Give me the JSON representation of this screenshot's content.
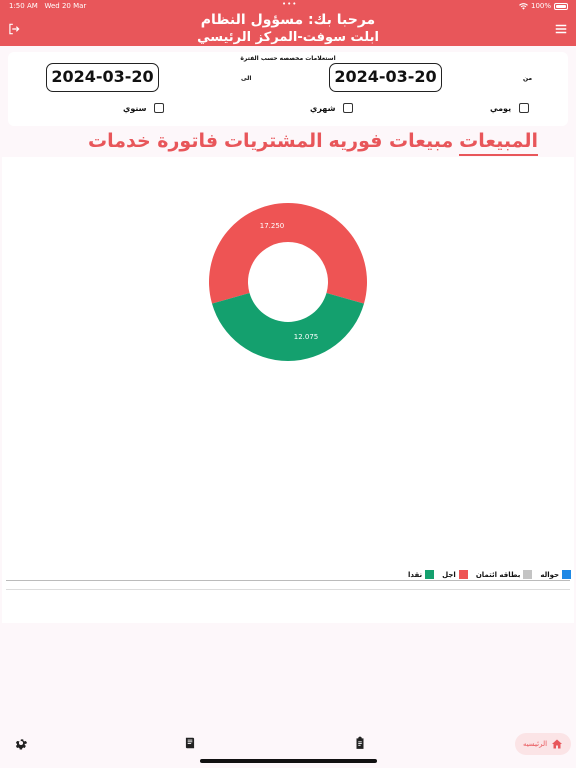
{
  "status_bar": {
    "time": "1:50 AM",
    "date": "Wed 20 Mar",
    "battery": "100%"
  },
  "header": {
    "greeting": "مرحبا بك: مسؤول النظام",
    "company": "ابلت سوفت-المركز الرئيسي",
    "background": "#e8565a"
  },
  "filters": {
    "caption": "استعلامات مخصصه حسب الفترة",
    "from_label": "من",
    "to_label": "الى",
    "from_date": "2024-03-20",
    "to_date": "2024-03-20",
    "periods": [
      {
        "label": "يومي",
        "checked": false
      },
      {
        "label": "شهري",
        "checked": false
      },
      {
        "label": "سنوي",
        "checked": false
      }
    ]
  },
  "tabs": [
    {
      "label": "المبيعات",
      "active": true
    },
    {
      "label": "مبيعات فوريه",
      "active": false
    },
    {
      "label": "المشتريات",
      "active": false
    },
    {
      "label": "فاتورة خدمات",
      "active": false
    }
  ],
  "chart_data": {
    "type": "pie",
    "categories": [
      "اجل",
      "نقدا"
    ],
    "values": [
      17250,
      12075
    ],
    "labels": [
      "17.250",
      "12.075"
    ],
    "colors": [
      "#ee5454",
      "#14a06e"
    ]
  },
  "legend": [
    {
      "label": "نقدا",
      "color": "#14a06e"
    },
    {
      "label": "اجل",
      "color": "#ee5454"
    },
    {
      "label": "بطاقه ائتمان",
      "color": "#c4c4c4"
    },
    {
      "label": "حواله",
      "color": "#1e88e5"
    }
  ],
  "bottom_nav": {
    "home_label": "الرئيسيه",
    "accent": "#e8565a"
  },
  "icons": {
    "logout": "logout-icon",
    "menu": "menu-icon",
    "settings": "gear-icon",
    "reports": "book-icon",
    "clipboard": "clipboard-icon",
    "home": "home-icon"
  }
}
